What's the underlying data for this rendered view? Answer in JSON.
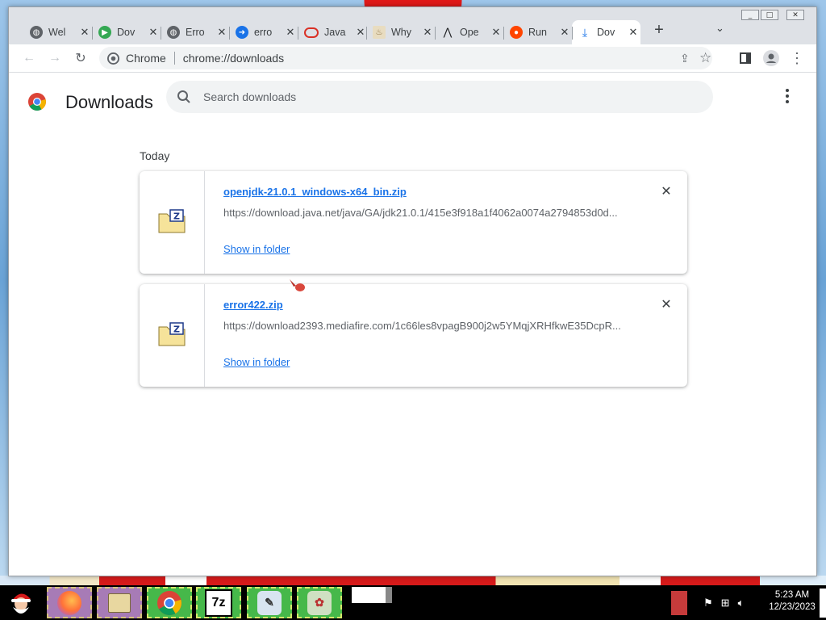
{
  "browser": {
    "tabs": [
      {
        "title": "Wel",
        "color": "#5f6368"
      },
      {
        "title": "Dov",
        "color": "#34a853"
      },
      {
        "title": "Erro",
        "color": "#5f6368"
      },
      {
        "title": "erro",
        "color": "#1a73e8"
      },
      {
        "title": "Java",
        "color": "#d93025"
      },
      {
        "title": "Why",
        "color": "#8a6d3b"
      },
      {
        "title": "Ope",
        "color": "#202124"
      },
      {
        "title": "Run",
        "color": "#ff4500"
      },
      {
        "title": "Dov",
        "color": "#1a73e8"
      }
    ],
    "window_controls": [
      "_",
      "□",
      "✕"
    ],
    "omnibox": {
      "site_label": "Chrome",
      "url": "chrome://downloads"
    }
  },
  "downloads": {
    "title": "Downloads",
    "search_placeholder": "Search downloads",
    "section_label": "Today",
    "items": [
      {
        "filename": "openjdk-21.0.1_windows-x64_bin.zip",
        "url": "https://download.java.net/java/GA/jdk21.0.1/415e3f918a1f4062a0074a2794853d0d...",
        "action": "Show in folder"
      },
      {
        "filename": "error422.zip",
        "url": "https://download2393.mediafire.com/1c66les8vpagB900j2w5YMqjXRHfkwE35DcpR...",
        "action": "Show in folder"
      }
    ]
  },
  "taskbar": {
    "clock_time": "5:23 AM",
    "clock_date": "12/23/2023",
    "apps": [
      "santa-start",
      "firefox",
      "file-manager",
      "chrome",
      "7zip",
      "tool-app",
      "paint-app"
    ],
    "accent": "#46b84a"
  }
}
